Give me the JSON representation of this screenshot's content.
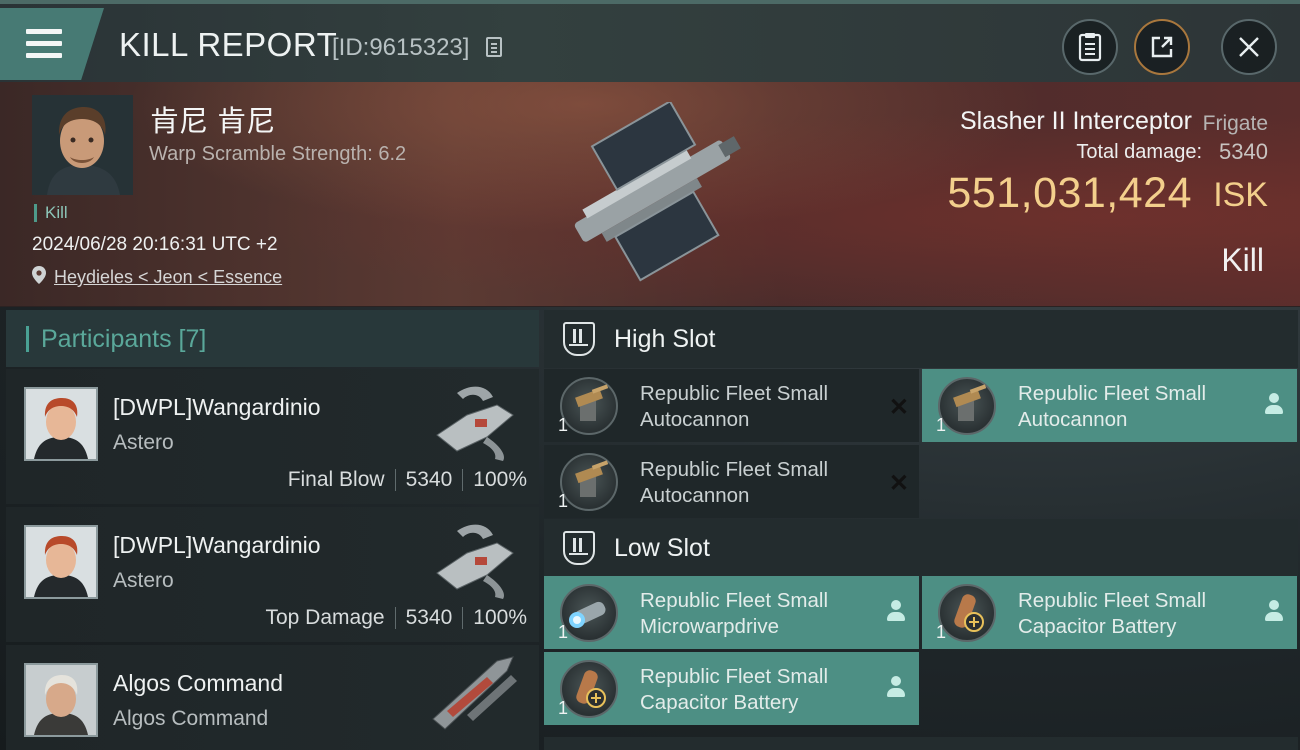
{
  "header": {
    "title": "KILL REPORT",
    "report_id": "[ID:9615323]",
    "buttons": [
      "clipboard-icon",
      "share-icon",
      "close-icon"
    ]
  },
  "victim": {
    "name": "肯尼 肯尼",
    "subtitle": "Warp Scramble Strength: 6.2",
    "tag": "Kill",
    "time": "2024/06/28 20:16:31 UTC +2",
    "location": "Heydieles < Jeon < Essence",
    "ship_name": "Slasher II Interceptor",
    "ship_class": "Frigate",
    "total_damage_label": "Total damage:",
    "total_damage": "5340",
    "isk_value": "551,031,424",
    "isk_unit": "ISK",
    "result": "Kill"
  },
  "participants": {
    "title": "Participants [7]",
    "rows": [
      {
        "name": "[DWPL]Wangardinio",
        "ship": "Astero",
        "role": "Final Blow",
        "damage": "5340",
        "percent": "100%"
      },
      {
        "name": "[DWPL]Wangardinio",
        "ship": "Astero",
        "role": "Top Damage",
        "damage": "5340",
        "percent": "100%"
      },
      {
        "name": "Algos Command",
        "ship": "Algos Command",
        "role": "",
        "damage": "",
        "percent": ""
      }
    ]
  },
  "fitting": {
    "high_slot": {
      "title": "High Slot",
      "items": [
        {
          "line1": "Republic Fleet Small",
          "line2": "Autocannon",
          "qty": "1",
          "status": "destroyed"
        },
        {
          "line1": "Republic Fleet Small",
          "line2": "Autocannon",
          "qty": "1",
          "status": "dropped"
        },
        {
          "line1": "Republic Fleet Small",
          "line2": "Autocannon",
          "qty": "1",
          "status": "destroyed"
        }
      ]
    },
    "low_slot": {
      "title": "Low Slot",
      "items": [
        {
          "line1": "Republic Fleet Small",
          "line2": "Microwarpdrive",
          "qty": "1",
          "status": "dropped"
        },
        {
          "line1": "Republic Fleet Small",
          "line2": "Capacitor Battery",
          "qty": "1",
          "status": "dropped"
        },
        {
          "line1": "Republic Fleet Small",
          "line2": "Capacitor Battery",
          "qty": "1",
          "status": "dropped"
        }
      ]
    }
  },
  "colors": {
    "accent_teal": "#4d8f84",
    "isk_gold": "#f3cf8c",
    "menu_teal": "#477a74"
  }
}
